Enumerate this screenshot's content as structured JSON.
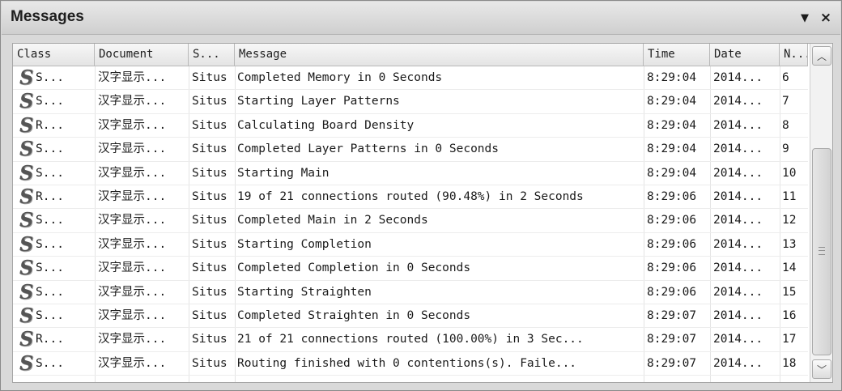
{
  "panel": {
    "title": "Messages",
    "menu_icon": "▼",
    "close_icon": "×"
  },
  "columns": {
    "class": "Class",
    "document": "Document",
    "source": "S...",
    "message": "Message",
    "time": "Time",
    "date": "Date",
    "number": "N..."
  },
  "rows": [
    {
      "icon": "situs-icon",
      "class": "S...",
      "document": "汉字显示...",
      "source": "Situs",
      "message": "Completed Memory in 0 Seconds",
      "time": "8:29:04",
      "date": "2014...",
      "number": "6"
    },
    {
      "icon": "situs-icon",
      "class": "S...",
      "document": "汉字显示...",
      "source": "Situs",
      "message": "Starting Layer Patterns",
      "time": "8:29:04",
      "date": "2014...",
      "number": "7"
    },
    {
      "icon": "situs-icon",
      "class": "R...",
      "document": "汉字显示...",
      "source": "Situs",
      "message": "Calculating Board Density",
      "time": "8:29:04",
      "date": "2014...",
      "number": "8"
    },
    {
      "icon": "situs-icon",
      "class": "S...",
      "document": "汉字显示...",
      "source": "Situs",
      "message": "Completed Layer Patterns in 0 Seconds",
      "time": "8:29:04",
      "date": "2014...",
      "number": "9"
    },
    {
      "icon": "situs-icon",
      "class": "S...",
      "document": "汉字显示...",
      "source": "Situs",
      "message": "Starting Main",
      "time": "8:29:04",
      "date": "2014...",
      "number": "10"
    },
    {
      "icon": "situs-icon",
      "class": "R...",
      "document": "汉字显示...",
      "source": "Situs",
      "message": "19 of 21 connections routed (90.48%) in 2 Seconds",
      "time": "8:29:06",
      "date": "2014...",
      "number": "11"
    },
    {
      "icon": "situs-icon",
      "class": "S...",
      "document": "汉字显示...",
      "source": "Situs",
      "message": "Completed Main in 2 Seconds",
      "time": "8:29:06",
      "date": "2014...",
      "number": "12"
    },
    {
      "icon": "situs-icon",
      "class": "S...",
      "document": "汉字显示...",
      "source": "Situs",
      "message": "Starting Completion",
      "time": "8:29:06",
      "date": "2014...",
      "number": "13"
    },
    {
      "icon": "situs-icon",
      "class": "S...",
      "document": "汉字显示...",
      "source": "Situs",
      "message": "Completed Completion in 0 Seconds",
      "time": "8:29:06",
      "date": "2014...",
      "number": "14"
    },
    {
      "icon": "situs-icon",
      "class": "S...",
      "document": "汉字显示...",
      "source": "Situs",
      "message": "Starting Straighten",
      "time": "8:29:06",
      "date": "2014...",
      "number": "15"
    },
    {
      "icon": "situs-icon",
      "class": "S...",
      "document": "汉字显示...",
      "source": "Situs",
      "message": "Completed Straighten in 0 Seconds",
      "time": "8:29:07",
      "date": "2014...",
      "number": "16"
    },
    {
      "icon": "situs-icon",
      "class": "R...",
      "document": "汉字显示...",
      "source": "Situs",
      "message": "21 of 21 connections routed (100.00%) in 3 Sec...",
      "time": "8:29:07",
      "date": "2014...",
      "number": "17"
    },
    {
      "icon": "situs-icon",
      "class": "S...",
      "document": "汉字显示...",
      "source": "Situs",
      "message": "Routing finished  with 0 contentions(s). Faile...",
      "time": "8:29:07",
      "date": "2014...",
      "number": "18"
    }
  ],
  "scrollbar": {
    "up_icon": "chevron-up-icon",
    "down_icon": "chevron-down-icon"
  }
}
